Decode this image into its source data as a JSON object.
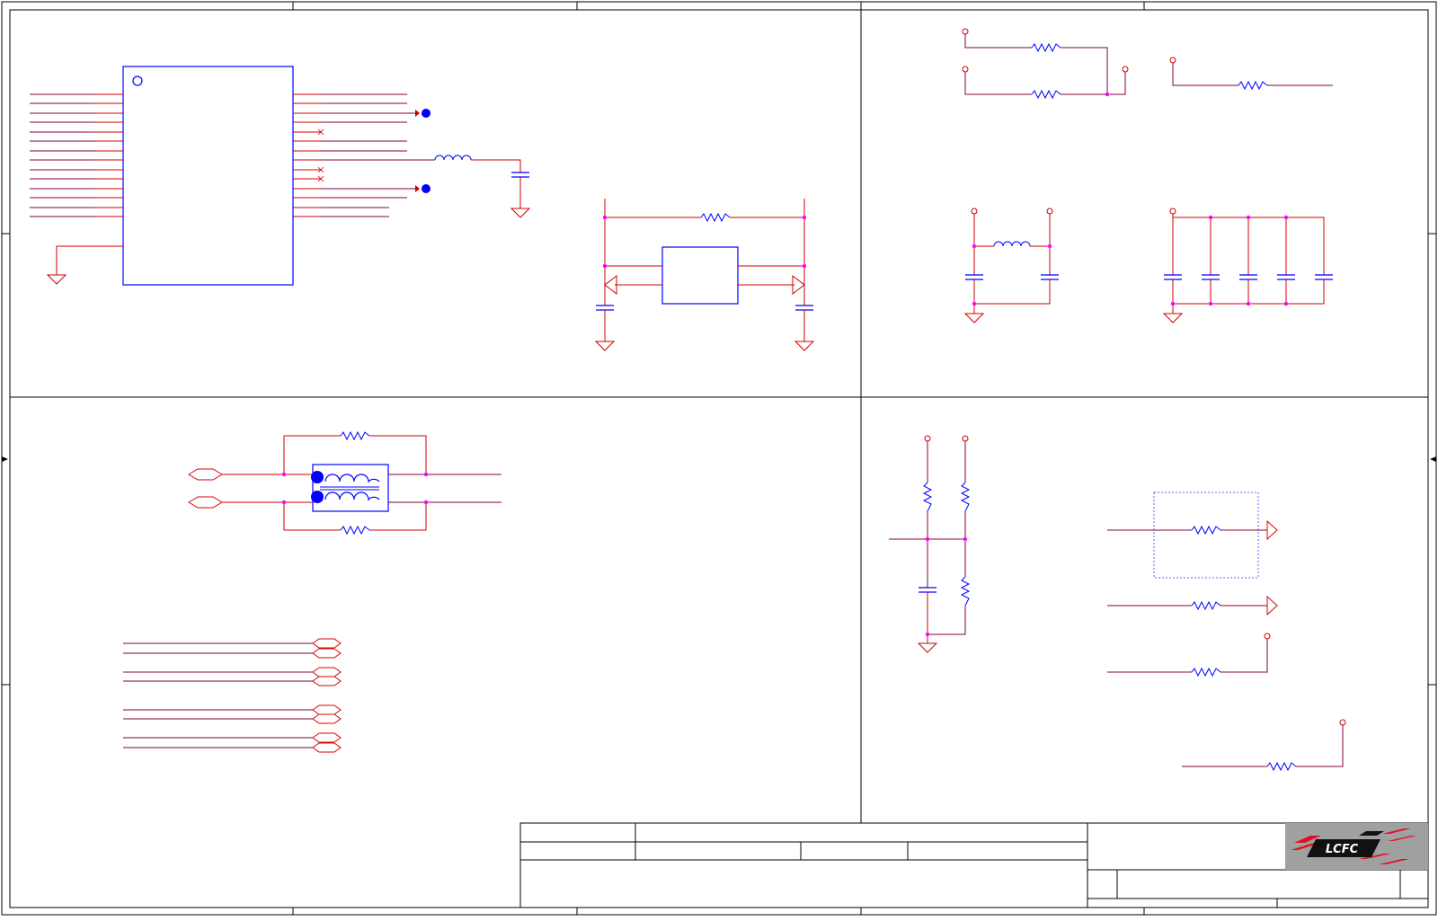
{
  "logo": {
    "text": "LCFC"
  },
  "colors": {
    "frame": "#000000",
    "wire": "#b00000",
    "signal": "#c00000",
    "wire_dark": "#800040",
    "part": "#0000ff",
    "junction": "#ff00ff",
    "flag": "#e00000",
    "logo_bg": "#a0a0a0",
    "logo_red": "#e01020"
  },
  "sections": [
    {
      "id": "top-left",
      "content": "controller-ic-block"
    },
    {
      "id": "top-right",
      "content": "passive-networks"
    },
    {
      "id": "bottom-left",
      "content": "common-mode-choke-block"
    },
    {
      "id": "bottom-right",
      "content": "bias-and-termination"
    }
  ],
  "title_block": {
    "logo_icon": "lcfc-logo-icon"
  }
}
